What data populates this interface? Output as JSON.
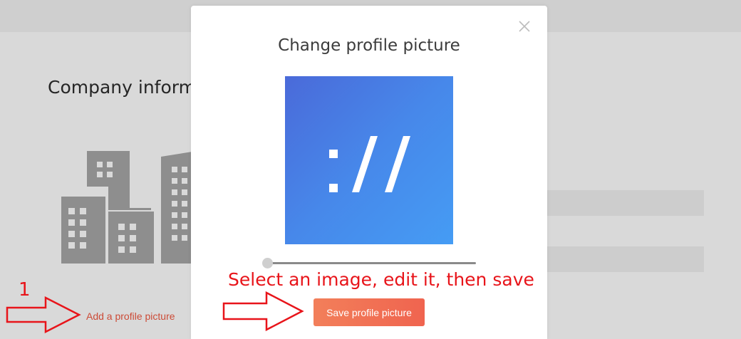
{
  "page": {
    "section_title": "Company inform",
    "add_picture_link": "Add a profile picture"
  },
  "modal": {
    "title": "Change profile picture",
    "close_icon": "close-icon",
    "preview_logo_text": "://",
    "zoom_slider_value": 0,
    "save_button_label": "Save profile picture"
  },
  "annotations": {
    "step_number": "1",
    "instruction": "Select an image, edit it, then save",
    "color": "#e8141a"
  },
  "colors": {
    "accent": "#f0644f",
    "link": "#cc4b37",
    "preview_gradient_start": "#4a6ad9",
    "preview_gradient_end": "#459cf4"
  }
}
